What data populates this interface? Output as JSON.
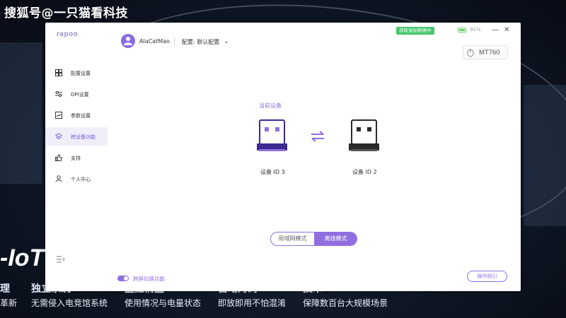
{
  "watermark": "搜狐号@一只猫看科技",
  "background": {
    "iot_text": "-IoT",
    "features": [
      {
        "head": "理",
        "sub": "革新"
      },
      {
        "head": "独立系统",
        "sub": "无需侵入电竞馆系统"
      },
      {
        "head": "监控情监",
        "sub": "使用情况与电量状态"
      },
      {
        "head": "自动对码",
        "sub": "即放即用不怕混淆"
      },
      {
        "head": "技术",
        "sub": "保障数百台大规模场景"
      }
    ]
  },
  "app": {
    "logo": "rapoo",
    "user": {
      "name": "AlaCatMao"
    },
    "config": {
      "label": "配置: 默认配置"
    },
    "status_badge": "获取鼠标数据中",
    "battery": "91%",
    "device": "MT760",
    "sidebar": {
      "items": [
        {
          "label": "配置设置",
          "icon": "grid-icon",
          "active": false
        },
        {
          "label": "DPI设置",
          "icon": "dpi-icon",
          "active": false
        },
        {
          "label": "参数设置",
          "icon": "chart-icon",
          "active": false
        },
        {
          "label": "跨设备功能",
          "icon": "layers-icon",
          "active": true
        },
        {
          "label": "支持",
          "icon": "thumbs-up-icon",
          "active": false
        },
        {
          "label": "个人中心",
          "icon": "person-icon",
          "active": false
        }
      ]
    },
    "main": {
      "current_label": "当前设备",
      "devices": [
        {
          "label": "设备 ID 3",
          "color": "#3d2a8f",
          "accent": "#8f6fe0"
        },
        {
          "label": "设备 ID 2",
          "color": "#2a2a2a",
          "accent": "#ffffff"
        }
      ],
      "mode": {
        "options": [
          "局域网模式",
          "离线模式"
        ],
        "selected": "离线模式"
      },
      "cross_screen": {
        "label": "跨屏切换功能",
        "enabled": true
      },
      "guide_button": "操作指引"
    }
  },
  "colors": {
    "accent": "#8f6fe0",
    "status_green": "#43c66b"
  }
}
